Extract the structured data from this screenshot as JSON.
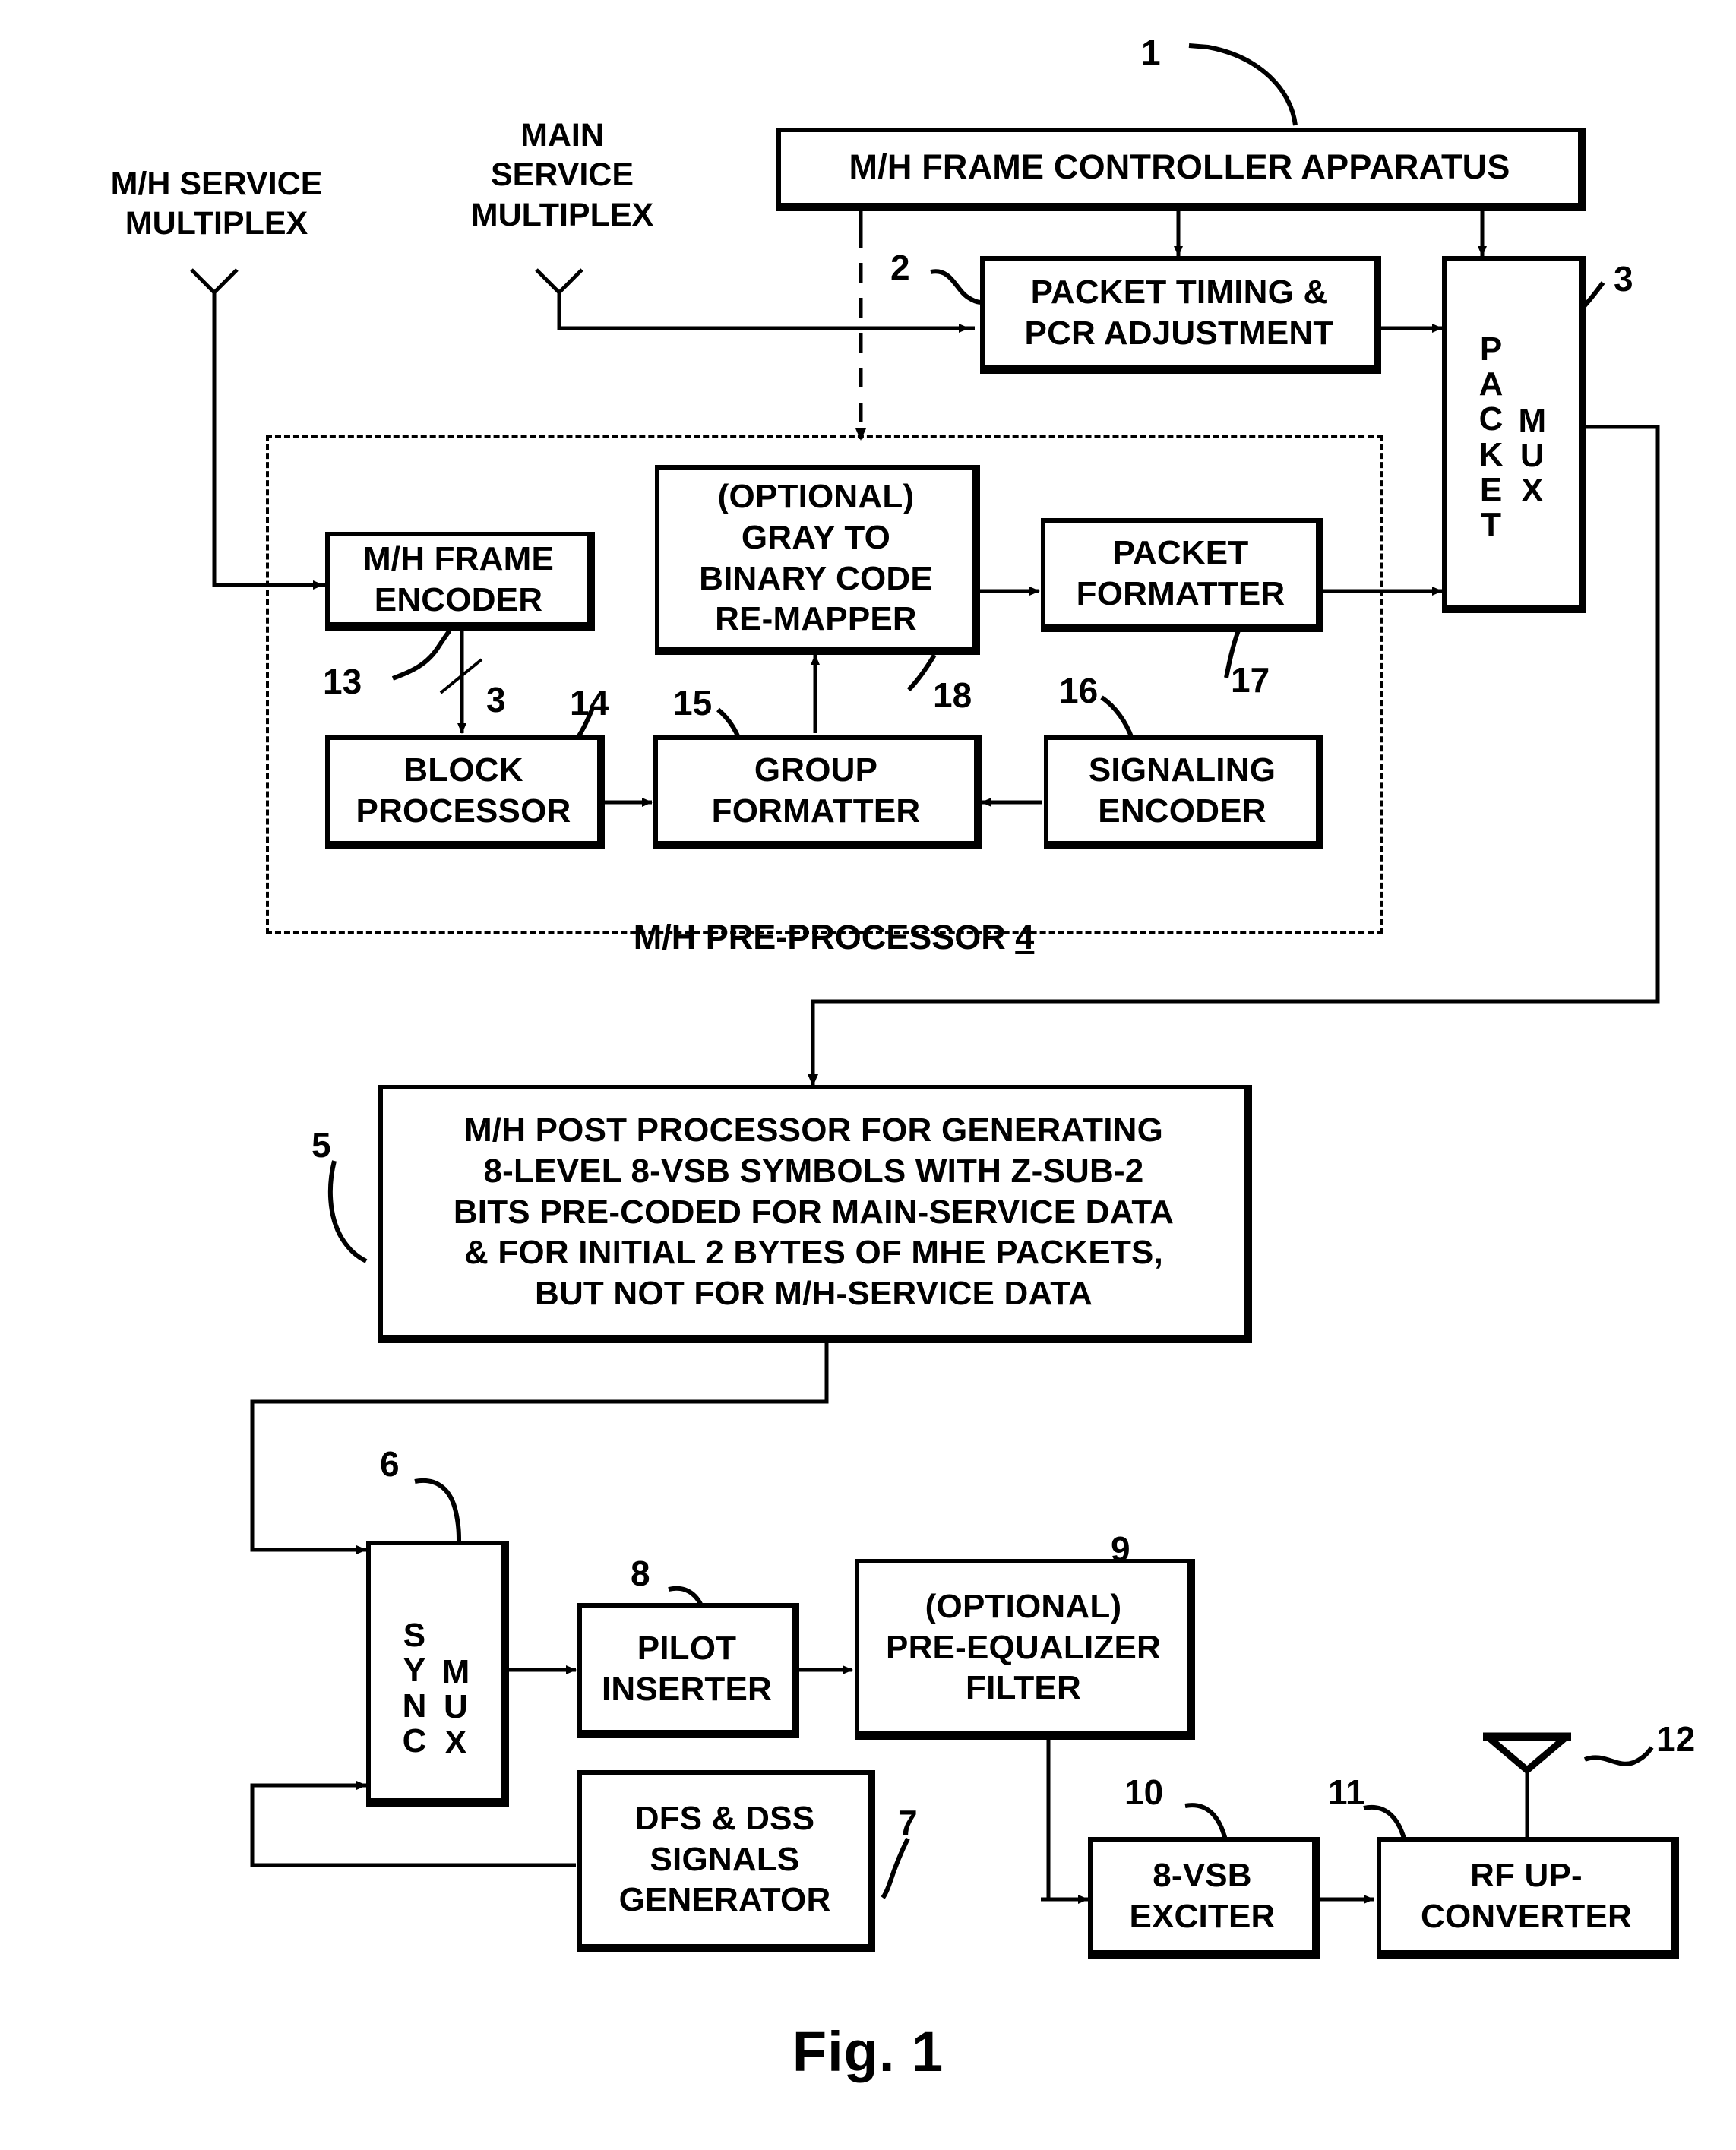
{
  "figure": {
    "caption": "Fig. 1",
    "title": "M/H transmitter block diagram"
  },
  "inputs": [
    {
      "name": "mh-service-multiplex",
      "label": "M/H SERVICE\nMULTIPLEX"
    },
    {
      "name": "main-service-multiplex",
      "label": "MAIN\nSERVICE\nMULTIPLEX"
    }
  ],
  "blocks": {
    "frame_controller": {
      "label": "M/H FRAME CONTROLLER APPARATUS",
      "ref": "1"
    },
    "packet_timing": {
      "label": "PACKET TIMING &\nPCR ADJUSTMENT",
      "ref": "2"
    },
    "packet_mux": {
      "label_left": "PACKET",
      "label_right": "MUX",
      "ref": "3"
    },
    "mh_frame_encoder": {
      "label": "M/H FRAME\nENCODER",
      "ref": "13",
      "bus": "3"
    },
    "gray_remapper": {
      "label": "(OPTIONAL)\nGRAY TO\nBINARY CODE\nRE-MAPPER",
      "ref": "18"
    },
    "packet_formatter": {
      "label": "PACKET\nFORMATTER",
      "ref": "17"
    },
    "block_processor": {
      "label": "BLOCK\nPROCESSOR",
      "ref": "14"
    },
    "group_formatter": {
      "label": "GROUP\nFORMATTER",
      "ref": "15"
    },
    "signaling_encoder": {
      "label": "SIGNALING\nENCODER",
      "ref": "16"
    },
    "preprocessor": {
      "label": "M/H PRE-PROCESSOR ",
      "ref": "4"
    },
    "post_processor": {
      "label": "M/H POST PROCESSOR FOR GENERATING\n8-LEVEL 8-VSB SYMBOLS WITH Z-SUB-2\nBITS PRE-CODED FOR MAIN-SERVICE DATA\n& FOR INITIAL 2 BYTES OF MHE PACKETS,\nBUT NOT FOR M/H-SERVICE DATA",
      "ref": "5"
    },
    "sync_mux": {
      "label_left": "SYNC",
      "label_right": "MUX",
      "ref": "6"
    },
    "dfs_dss": {
      "label": "DFS & DSS\nSIGNALS\nGENERATOR",
      "ref": "7"
    },
    "pilot_inserter": {
      "label": "PILOT\nINSERTER",
      "ref": "8"
    },
    "pre_equalizer": {
      "label": "(OPTIONAL)\nPRE-EQUALIZER\nFILTER",
      "ref": "9"
    },
    "vsb_exciter": {
      "label": "8-VSB\nEXCITER",
      "ref": "10"
    },
    "rf_upconverter": {
      "label": "RF UP-\nCONVERTER",
      "ref": "11"
    },
    "antenna": {
      "label": "",
      "ref": "12",
      "icon": "antenna-icon"
    }
  },
  "colors": {
    "ink": "#000000",
    "paper": "#ffffff"
  }
}
